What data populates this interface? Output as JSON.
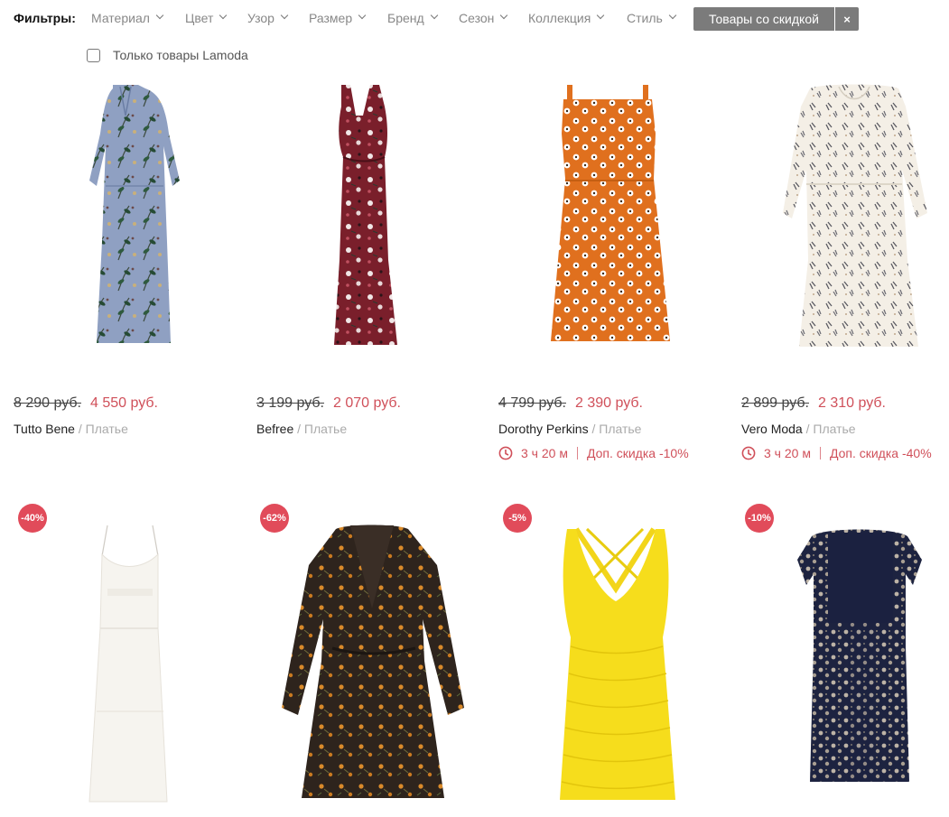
{
  "filters": {
    "label": "Фильтры:",
    "items": [
      "Материал",
      "Цвет",
      "Узор",
      "Размер",
      "Бренд",
      "Сезон",
      "Коллекция",
      "Стиль"
    ],
    "active_chip": "Товары со скидкой",
    "close_glyph": "×"
  },
  "only_lamoda": {
    "label": "Только товары Lamoda",
    "checked": false
  },
  "products": [
    {
      "old_price": "8 290 руб.",
      "new_price": "4 550 руб.",
      "brand": "Tutto Bene",
      "sep": " / ",
      "category": "Платье"
    },
    {
      "old_price": "3 199 руб.",
      "new_price": "2 070 руб.",
      "brand": "Befree",
      "sep": " / ",
      "category": "Платье"
    },
    {
      "old_price": "4 799 руб.",
      "new_price": "2 390 руб.",
      "brand": "Dorothy Perkins",
      "sep": " / ",
      "category": "Платье",
      "timer": "3 ч 20 м",
      "extra": "Доп. скидка -10%"
    },
    {
      "old_price": "2 899 руб.",
      "new_price": "2 310 руб.",
      "brand": "Vero Moda",
      "sep": " / ",
      "category": "Платье",
      "timer": "3 ч 20 м",
      "extra": "Доп. скидка -40%"
    },
    {
      "badge": "-40%"
    },
    {
      "badge": "-62%"
    },
    {
      "badge": "-5%"
    },
    {
      "badge": "-10%"
    }
  ],
  "colors": {
    "accent": "#d0505a",
    "badge": "#e14b5a",
    "chip": "#7b7b7b"
  }
}
